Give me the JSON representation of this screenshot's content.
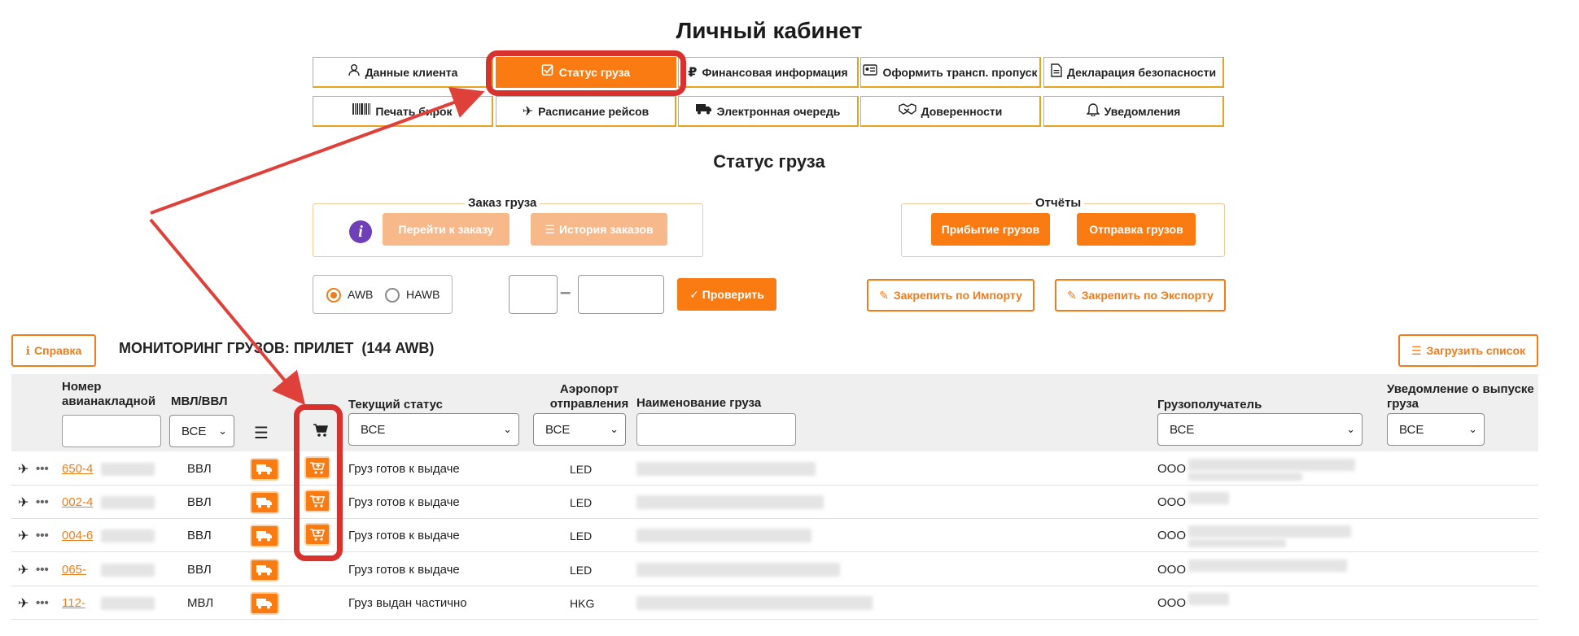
{
  "page_title": "Личный кабинет",
  "nav": [
    {
      "label": "Данные клиента",
      "icon": "user-icon"
    },
    {
      "label": "Статус груза",
      "icon": "checkbox-icon",
      "active": true
    },
    {
      "label": "Финансовая информация",
      "icon": "ruble-icon"
    },
    {
      "label": "Оформить трансп. пропуск",
      "icon": "id-card-icon"
    },
    {
      "label": "Декларация безопасности",
      "icon": "document-icon"
    },
    {
      "label": "Печать бирок",
      "icon": "barcode-icon"
    },
    {
      "label": "Расписание рейсов",
      "icon": "plane-icon"
    },
    {
      "label": "Электронная очередь",
      "icon": "truck-icon"
    },
    {
      "label": "Доверенности",
      "icon": "handshake-icon"
    },
    {
      "label": "Уведомления",
      "icon": "bell-icon"
    }
  ],
  "section_title": "Статус груза",
  "order": {
    "legend": "Заказ груза",
    "go_label": "Перейти к заказу",
    "history_label": "История заказов"
  },
  "reports": {
    "legend": "Отчёты",
    "arrival_label": "Прибытие грузов",
    "departure_label": "Отправка грузов"
  },
  "search": {
    "awb_label": "AWB",
    "hawb_label": "HAWB",
    "selected": "AWB",
    "dash": "–",
    "check_label": "✓ Проверить"
  },
  "pin_import_label": "Закрепить по Импорту",
  "pin_export_label": "Закрепить по Экспорту",
  "help_label": "Справка",
  "monitor_title": "МОНИТОРИНГ ГРУЗОВ: ПРИЛЕТ  (144 AWB)",
  "upload_label": "Загрузить список",
  "columns": {
    "awb": "Номер авианакладной",
    "mvl": "МВЛ/ВВЛ",
    "status": "Текущий статус",
    "airport": "Аэропорт отправления",
    "cargo": "Наименование груза",
    "consignee": "Грузополучатель",
    "release": "Уведомление о выпуске груза"
  },
  "filters": {
    "mvl": "ВСЕ",
    "status": "ВСЕ",
    "airport": "ВСЕ",
    "consignee": "ВСЕ",
    "release": "ВСЕ"
  },
  "rows": [
    {
      "awb": "650-4",
      "type": "ВВЛ",
      "status": "Груз готов к выдаче",
      "airport": "LED",
      "consignee": "ООО",
      "cart": true
    },
    {
      "awb": "002-4",
      "type": "ВВЛ",
      "status": "Груз готов к выдаче",
      "airport": "LED",
      "consignee": "ООО",
      "cart": true
    },
    {
      "awb": "004-6",
      "type": "ВВЛ",
      "status": "Груз готов к выдаче",
      "airport": "LED",
      "consignee": "ООО",
      "cart": true
    },
    {
      "awb": "065-",
      "type": "ВВЛ",
      "status": "Груз готов к выдаче",
      "airport": "LED",
      "consignee": "ООО",
      "cart": false
    },
    {
      "awb": "112-",
      "type": "МВЛ",
      "status": "Груз выдан частично",
      "airport": "HKG",
      "consignee": "ООО",
      "cart": false
    }
  ],
  "colors": {
    "accent": "#f97b12",
    "highlight": "#d9322e",
    "arrow": "#e0403a"
  }
}
